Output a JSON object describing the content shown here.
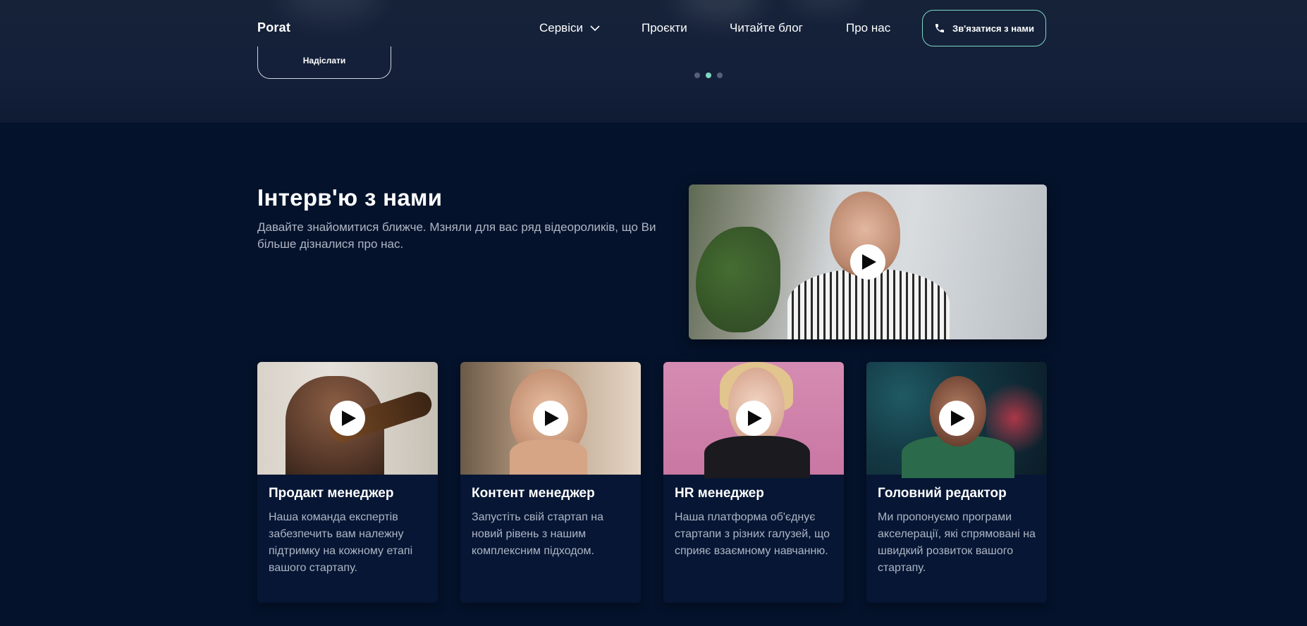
{
  "header": {
    "logo": "Porat",
    "nav": {
      "services": "Сервіси",
      "projects": "Проєкти",
      "blog": "Читайте блог",
      "about": "Про нас"
    },
    "cta_label": "Зв'язатися з нами"
  },
  "hero": {
    "submit_label": "Надіслати",
    "carousel_active": 2,
    "carousel_total": 3
  },
  "interview": {
    "title": "Інтерв'ю з нами",
    "description": "Давайте знайомитися ближче. Мзняли для вас ряд відеороликів, що Ви більше дізналися про нас."
  },
  "cards": [
    {
      "title": "Продакт менеджер",
      "text": "Наша команда експертів забезпечить вам належну підтримку на кожному етапі вашого стартапу."
    },
    {
      "title": "Контент менеджер",
      "text": "Запустіть свій стартап на новий рівень з нашим комплексним підходом."
    },
    {
      "title": "HR менеджер",
      "text": "Наша платформа об'єднує стартапи з різних галузей, що сприяє взаємному навчанню."
    },
    {
      "title": "Головний редактор",
      "text": "Ми пропонуємо програми акселерації, які спрямовані на швидкий розвиток вашого стартапу."
    }
  ],
  "colors": {
    "background": "#04122b",
    "accent": "#7fd6c2",
    "card": "#061634"
  },
  "icons": [
    "chevron-down-icon",
    "phone-icon",
    "play-icon"
  ]
}
